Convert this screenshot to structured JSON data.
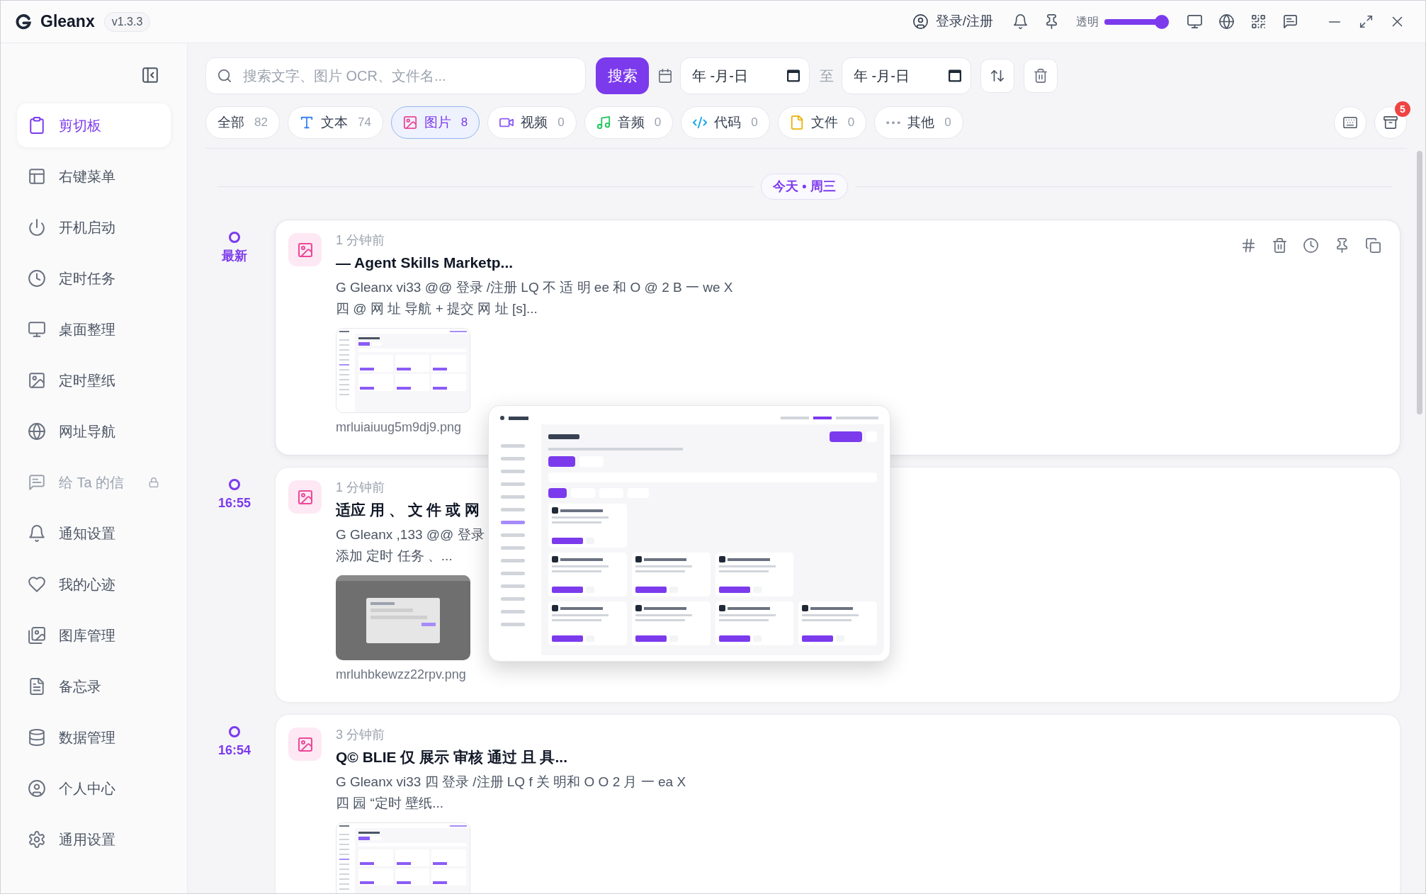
{
  "window": {
    "app_name": "Gleanx",
    "version": "v1.3.3"
  },
  "header": {
    "account": "登录/注册",
    "opacity_label": "透明",
    "opacity_slider": {
      "level": 0.88
    }
  },
  "sidebar": {
    "items": [
      {
        "label": "剪切板",
        "selected": true,
        "locked": false
      },
      {
        "label": "右键菜单",
        "selected": false,
        "locked": false
      },
      {
        "label": "开机启动",
        "selected": false,
        "locked": false
      },
      {
        "label": "定时任务",
        "selected": false,
        "locked": false
      },
      {
        "label": "桌面整理",
        "selected": false,
        "locked": false
      },
      {
        "label": "定时壁纸",
        "selected": false,
        "locked": false
      },
      {
        "label": "网址导航",
        "selected": false,
        "locked": false
      },
      {
        "label": "给 Ta 的信",
        "selected": false,
        "locked": true
      },
      {
        "label": "通知设置",
        "selected": false,
        "locked": false
      },
      {
        "label": "我的心迹",
        "selected": false,
        "locked": false
      },
      {
        "label": "图库管理",
        "selected": false,
        "locked": false
      },
      {
        "label": "备忘录",
        "selected": false,
        "locked": false
      },
      {
        "label": "数据管理",
        "selected": false,
        "locked": false
      },
      {
        "label": "个人中心",
        "selected": false,
        "locked": false
      },
      {
        "label": "通用设置",
        "selected": false,
        "locked": false
      }
    ]
  },
  "search": {
    "placeholder": "搜索文字、图片 OCR、文件名...",
    "button": "搜索",
    "date_from": {
      "placeholder": "年 -月-日"
    },
    "range_separator": "至",
    "date_to": {
      "placeholder": "年 -月-日"
    }
  },
  "filter_tabs": [
    {
      "label": "全部",
      "count": "82",
      "selected": false
    },
    {
      "label": "文本",
      "count": "74",
      "selected": false,
      "color": "#3b82f6"
    },
    {
      "label": "图片",
      "count": "8",
      "selected": true,
      "color": "#ec4899"
    },
    {
      "label": "视频",
      "count": "0",
      "selected": false,
      "color": "#8b5cf6"
    },
    {
      "label": "音频",
      "count": "0",
      "selected": false,
      "color": "#22c55e"
    },
    {
      "label": "代码",
      "count": "0",
      "selected": false,
      "color": "#0ea5e9"
    },
    {
      "label": "文件",
      "count": "0",
      "selected": false,
      "color": "#eab308"
    },
    {
      "label": "其他",
      "count": "0",
      "selected": false,
      "color": "#9ca3af"
    }
  ],
  "archive": {
    "badge": "5"
  },
  "date_divider": "今天 • 周三",
  "entries": [
    {
      "marker": "最新",
      "time": "1 分钟前",
      "title": "— Agent Skills Marketp...",
      "text_lines": [
        "G Gleanx vi33 @@ 登录 /注册 LQ 不 适 明 ee 和 O @ 2 B 一 we X",
        "四 @ 网 址 导航 + 提交 网 址 [s]..."
      ],
      "file_name": "mrluiaiuug5m9dj9.png",
      "hovered": true
    },
    {
      "marker": "16:55",
      "time": "1 分钟前",
      "title": "适应 用 、 文 件 或 网",
      "text_lines": [
        "G Gleanx ,133 @@ 登录",
        "添加 定时 任务 、..."
      ],
      "file_name": "mrluhbkewzz22rpv.png",
      "hovered": false
    },
    {
      "marker": "16:54",
      "time": "3 分钟前",
      "title": "Q© BLIE 仅 展示 审核 通过 且 具...",
      "text_lines": [
        "G Gleanx vi33 四 登录 /注册 LQ f 关 明和 O O 2 月 一 ea X",
        "四 园 “定时 壁纸..."
      ],
      "hovered": false
    }
  ]
}
